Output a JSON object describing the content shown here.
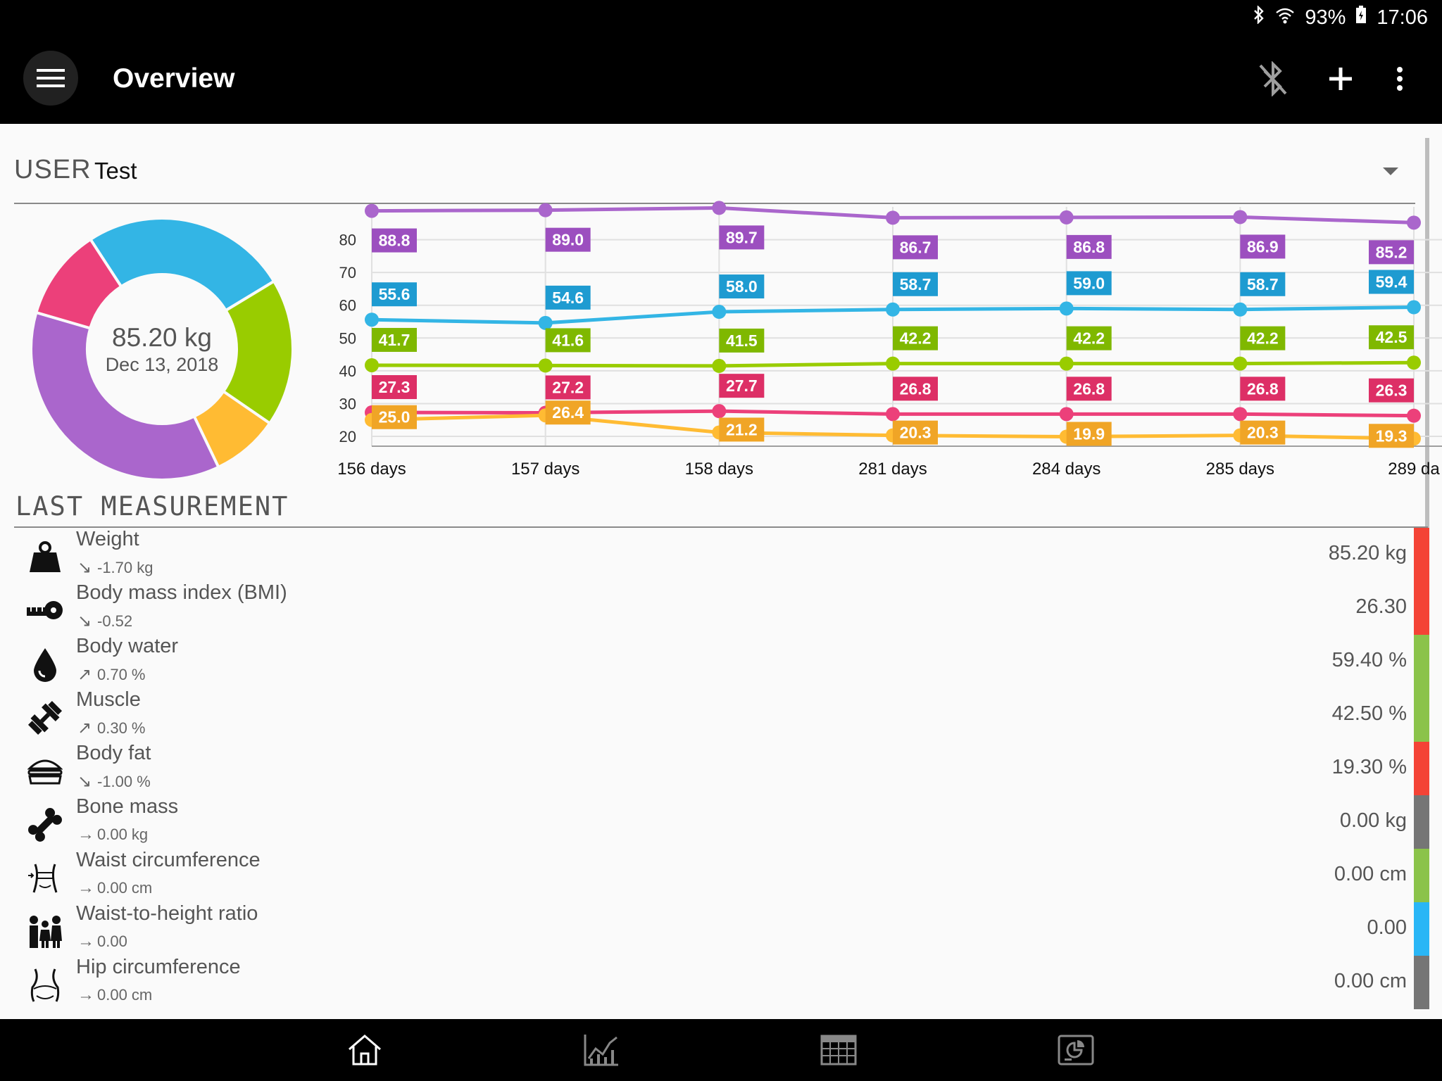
{
  "status_bar": {
    "battery": "93%",
    "time": "17:06"
  },
  "app_bar": {
    "title": "Overview"
  },
  "user": {
    "label": "USER",
    "name": "Test"
  },
  "donut": {
    "value": "85.20 kg",
    "date": "Dec 13, 2018",
    "segments": [
      {
        "name": "water",
        "color": "#33b5e5",
        "value": 59.4
      },
      {
        "name": "muscle",
        "color": "#99cc00",
        "value": 42.5
      },
      {
        "name": "fat",
        "color": "#ffbb33",
        "value": 19.3
      },
      {
        "name": "weight",
        "color": "#aa66cc",
        "value": 85.2
      },
      {
        "name": "bmi",
        "color": "#ec407a",
        "value": 26.3
      }
    ]
  },
  "chart_data": {
    "type": "line",
    "categories": [
      "156 days",
      "157 days",
      "158 days",
      "281 days",
      "284 days",
      "285 days",
      "289 da"
    ],
    "yticks": [
      80,
      70,
      60,
      50,
      40,
      30,
      20
    ],
    "ylim": [
      17,
      90
    ],
    "series": [
      {
        "color": "#aa66cc",
        "label_color": "#9c4fbf",
        "values": [
          88.8,
          89.0,
          89.7,
          86.7,
          86.8,
          86.9,
          85.2
        ]
      },
      {
        "color": "#33b5e5",
        "label_color": "#1e9bd1",
        "values": [
          55.6,
          54.6,
          58.0,
          58.7,
          59.0,
          58.7,
          59.4
        ]
      },
      {
        "color": "#99cc00",
        "label_color": "#7fb800",
        "values": [
          41.7,
          41.6,
          41.5,
          42.2,
          42.2,
          42.2,
          42.5
        ]
      },
      {
        "color": "#ec407a",
        "label_color": "#dd2f66",
        "values": [
          27.3,
          27.2,
          27.7,
          26.8,
          26.8,
          26.8,
          26.3
        ]
      },
      {
        "color": "#ffbb33",
        "label_color": "#f0a526",
        "values": [
          25.0,
          26.4,
          21.2,
          20.3,
          19.9,
          20.3,
          19.3
        ]
      }
    ],
    "xlabel": "",
    "ylabel": ""
  },
  "last_measurement": {
    "title": "LAST MEASUREMENT",
    "rows": [
      {
        "name": "Weight",
        "delta": "-1.70 kg",
        "trend": "↘",
        "value": "85.20 kg",
        "icon": "weight-icon",
        "bar": "#f44336"
      },
      {
        "name": "Body mass index (BMI)",
        "delta": "-0.52",
        "trend": "↘",
        "value": "26.30",
        "icon": "tape-measure-icon",
        "bar": "#f44336"
      },
      {
        "name": "Body water",
        "delta": "0.70 %",
        "trend": "↗",
        "value": "59.40 %",
        "icon": "water-drop-icon",
        "bar": "#8bc34a"
      },
      {
        "name": "Muscle",
        "delta": "0.30 %",
        "trend": "↗",
        "value": "42.50 %",
        "icon": "dumbbell-icon",
        "bar": "#8bc34a"
      },
      {
        "name": "Body fat",
        "delta": "-1.00 %",
        "trend": "↘",
        "value": "19.30 %",
        "icon": "burger-icon",
        "bar": "#f44336"
      },
      {
        "name": "Bone mass",
        "delta": "0.00 kg",
        "trend": "→",
        "value": "0.00 kg",
        "icon": "bone-icon",
        "bar": "#757575"
      },
      {
        "name": "Waist circumference",
        "delta": "0.00 cm",
        "trend": "→",
        "value": "0.00 cm",
        "icon": "waist-icon",
        "bar": "#8bc34a"
      },
      {
        "name": "Waist-to-height ratio",
        "delta": "0.00",
        "trend": "→",
        "value": "0.00",
        "icon": "family-icon",
        "bar": "#29b6f6"
      },
      {
        "name": "Hip circumference",
        "delta": "0.00 cm",
        "trend": "→",
        "value": "0.00 cm",
        "icon": "hip-icon",
        "bar": "#757575"
      }
    ]
  }
}
